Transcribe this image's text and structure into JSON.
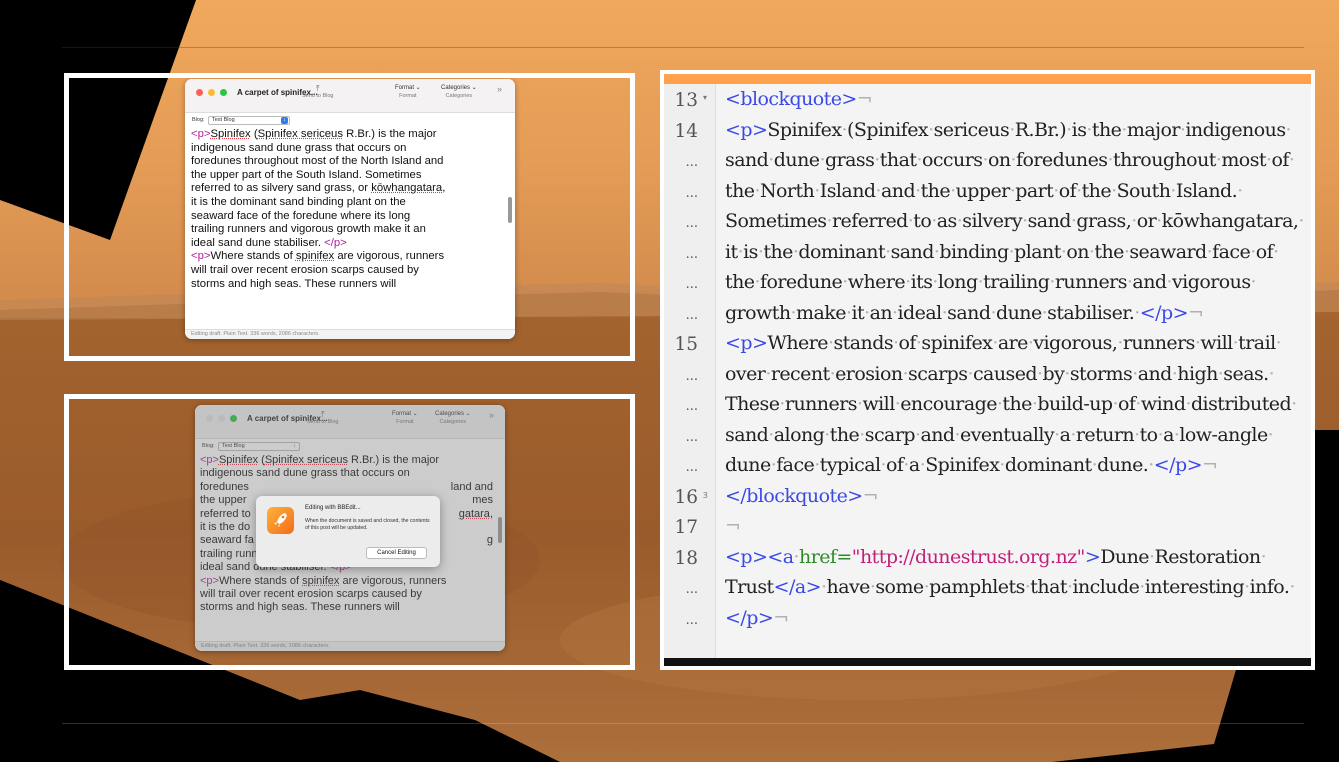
{
  "app_window": {
    "title": "A carpet of spinifex...",
    "toolbar": {
      "send_label": "Send to Blog",
      "format_popup": "Format ⌄",
      "format_label": "Format",
      "categories_popup": "Categories ⌄",
      "categories_label": "Categories",
      "overflow": "»"
    },
    "blog_label": "Blog:",
    "blog_value": "Test Blog",
    "status": "Editing draft. Plain Text. 336 words, 2086 characters.",
    "body": {
      "p_open": "<p>",
      "p_close": "</p>",
      "para1_word1": "Spinifex",
      "para1_paren_open": " (",
      "para1_sci": "Spinifex sericeus",
      "para1_a": " R.Br.) is the major",
      "para1_l2": "indigenous sand dune grass that occurs on",
      "para1_l3": "foredunes throughout most of the North Island and",
      "para1_l4": "the upper part of the South Island. Sometimes",
      "para1_l5a": "referred to as silvery sand grass, or ",
      "para1_kow": "kōwhangatara",
      "para1_l5b": ",",
      "para1_l6": "it is the dominant sand binding plant on the",
      "para1_l7": "seaward face of the foredune where its long",
      "para1_l8": "trailing runners and vigorous growth make it an",
      "para1_l9": "ideal sand dune stabiliser. ",
      "para2_a": "Where stands of ",
      "para2_spin": "spinifex",
      "para2_b": " are vigorous, runners",
      "para2_l2": "will trail over recent erosion scarps caused by",
      "para2_l3": "storms and high seas. These runners will"
    }
  },
  "app_window_dimmed": {
    "title": "A carpet of spinifex...",
    "send_label": "Send to Blog",
    "format_popup": "Format ⌄",
    "format_label": "Format",
    "categories_popup": "Categories ⌄",
    "categories_label": "Categories",
    "blog_label": "Blog:",
    "blog_value": "Test Blog",
    "status": "Editing draft. Plain Text. 336 words, 2086 characters.",
    "partial_l3_left": "foredunes",
    "partial_l3_right": "land and",
    "partial_l4_left": "the upper",
    "partial_l4_right": "mes",
    "partial_l5_left": "referred to",
    "partial_l5_right": "gatara",
    "partial_l5_comma": ",",
    "partial_l6_left": "it is the do",
    "partial_l7_left": "seaward fa",
    "partial_l7_right": "g",
    "dialog": {
      "title": "Editing with BBEdit...",
      "message": "When the document is saved and closed, the contents of this post will be updated.",
      "cancel": "Cancel Editing"
    }
  },
  "editor": {
    "lines": [
      {
        "num": "13",
        "fold": "▾",
        "segs": [
          [
            "tag",
            "<blockquote>"
          ],
          [
            "ws",
            "¬"
          ]
        ]
      },
      {
        "num": "14",
        "fold": "",
        "segs": [
          [
            "tag",
            "<p>"
          ],
          [
            "txt",
            "Spinifex·(Spinifex·sericeus·R.Br.)·is·the·major·indigenous·"
          ]
        ]
      },
      {
        "num": "...",
        "fold": "",
        "segs": [
          [
            "txt",
            "sand·dune·grass·that·occurs·on·foredunes·throughout·most·of·"
          ]
        ]
      },
      {
        "num": "...",
        "fold": "",
        "segs": [
          [
            "txt",
            "the·North·Island·and·the·upper·part·of·the·South·Island.·"
          ]
        ]
      },
      {
        "num": "...",
        "fold": "",
        "segs": [
          [
            "txt",
            "Sometimes·referred·to·as·silvery·sand·grass,·or·kōwhangatara,·"
          ]
        ]
      },
      {
        "num": "...",
        "fold": "",
        "segs": [
          [
            "txt",
            "it·is·the·dominant·sand·binding·plant·on·the·seaward·face·of·"
          ]
        ]
      },
      {
        "num": "...",
        "fold": "",
        "segs": [
          [
            "txt",
            "the·foredune·where·its·long·trailing·runners·and·vigorous·"
          ]
        ]
      },
      {
        "num": "...",
        "fold": "",
        "segs": [
          [
            "txt",
            "growth·make·it·an·ideal·sand·dune·stabiliser.·"
          ],
          [
            "tag",
            "</p>"
          ],
          [
            "ws",
            "¬"
          ]
        ]
      },
      {
        "num": "15",
        "fold": "",
        "segs": [
          [
            "tag",
            "<p>"
          ],
          [
            "txt",
            "Where·stands·of·spinifex·are·vigorous,·runners·will·trail·"
          ]
        ]
      },
      {
        "num": "...",
        "fold": "",
        "segs": [
          [
            "txt",
            "over·recent·erosion·scarps·caused·by·storms·and·high·seas.·"
          ]
        ]
      },
      {
        "num": "...",
        "fold": "",
        "segs": [
          [
            "txt",
            "These·runners·will·encourage·the·build-up·of·wind·distributed·"
          ]
        ]
      },
      {
        "num": "...",
        "fold": "",
        "segs": [
          [
            "txt",
            "sand·along·the·scarp·and·eventually·a·return·to·a·low-angle·"
          ]
        ]
      },
      {
        "num": "...",
        "fold": "",
        "segs": [
          [
            "txt",
            "dune·face·typical·of·a·Spinifex·dominant·dune.·"
          ],
          [
            "tag",
            "</p>"
          ],
          [
            "ws",
            "¬"
          ]
        ]
      },
      {
        "num": "16",
        "fold": "Ⳍ",
        "segs": [
          [
            "tag",
            "</blockquote>"
          ],
          [
            "ws",
            "¬"
          ]
        ]
      },
      {
        "num": "17",
        "fold": "",
        "segs": [
          [
            "ws",
            "¬"
          ]
        ]
      },
      {
        "num": "18",
        "fold": "",
        "segs": [
          [
            "tag",
            "<p><a"
          ],
          [
            "txt",
            "·"
          ],
          [
            "attr",
            "href="
          ],
          [
            "str",
            "\"http://dunestrust.org.nz\""
          ],
          [
            "tag",
            ">"
          ],
          [
            "txt",
            "Dune·Restoration·"
          ]
        ]
      },
      {
        "num": "...",
        "fold": "",
        "segs": [
          [
            "txt",
            "Trust"
          ],
          [
            "tag",
            "</a>"
          ],
          [
            "txt",
            "·have·some·pamphlets·that·include·interesting·info.·"
          ]
        ]
      },
      {
        "num": "...",
        "fold": "",
        "segs": [
          [
            "tag",
            "</p>"
          ],
          [
            "ws",
            "¬"
          ]
        ]
      }
    ]
  }
}
